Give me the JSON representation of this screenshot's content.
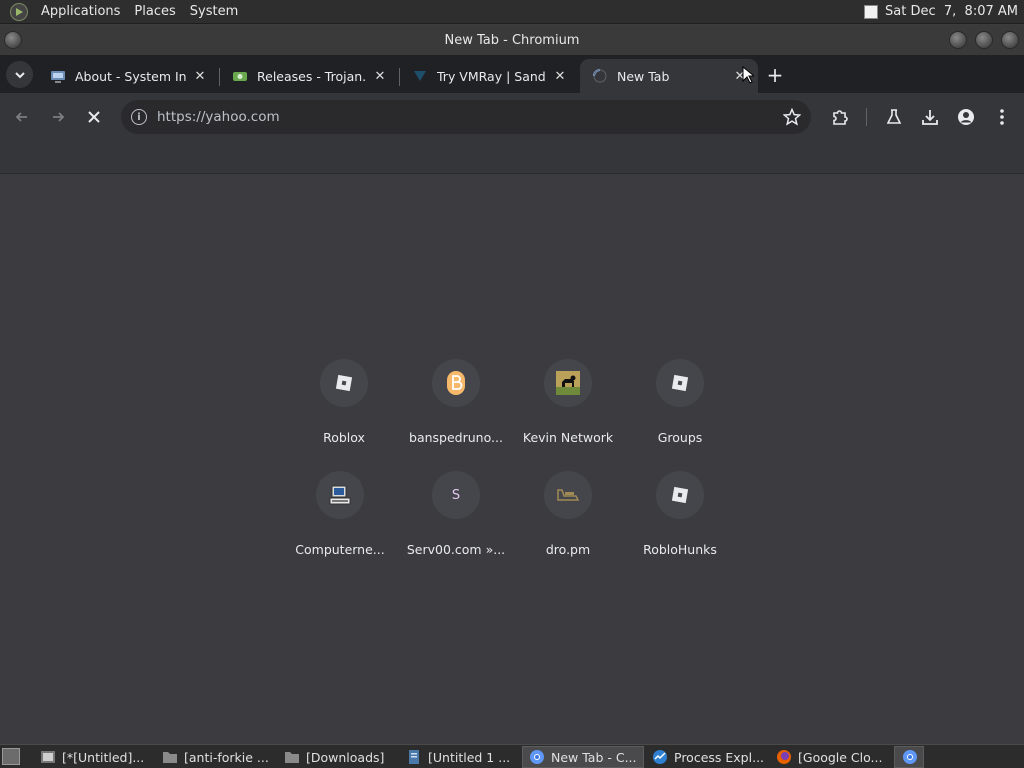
{
  "system_panel": {
    "menus": [
      "Applications",
      "Places",
      "System"
    ],
    "clock": "Sat Dec  7,  8:07 AM"
  },
  "window": {
    "title": "New Tab - Chromium"
  },
  "tabs": [
    {
      "title": "About - System Inf",
      "icon": "system-info-icon",
      "active": false
    },
    {
      "title": "Releases - Trojan.c",
      "icon": "github-releases-icon",
      "active": false
    },
    {
      "title": "Try VMRay | Sandb",
      "icon": "vmray-icon",
      "active": false
    },
    {
      "title": "New Tab",
      "icon": "loading-spinner-icon",
      "active": true
    }
  ],
  "toolbar": {
    "url": "https://yahoo.com",
    "loading": true
  },
  "shortcuts": [
    {
      "label": "Roblox",
      "icon": "roblox-icon"
    },
    {
      "label": "banspedruno...",
      "icon": "banspedrun-icon"
    },
    {
      "label": "Kevin Network",
      "icon": "kevin-network-icon"
    },
    {
      "label": "Groups",
      "icon": "roblox-icon"
    },
    {
      "label": "Computerne...",
      "icon": "computer-icon"
    },
    {
      "label": "Serv00.com »...",
      "icon": "letter-s-icon",
      "letter": "S"
    },
    {
      "label": "dro.pm",
      "icon": "dro-pm-icon"
    },
    {
      "label": "RobloHunks",
      "icon": "roblox-icon"
    }
  ],
  "taskbar": {
    "items": [
      {
        "label": "[*[Untitled]...",
        "icon": "editor-icon"
      },
      {
        "label": "[anti-forkie ...",
        "icon": "folder-icon"
      },
      {
        "label": "[Downloads]",
        "icon": "folder-icon"
      },
      {
        "label": "[Untitled 1 ...",
        "icon": "document-icon"
      },
      {
        "label": "New Tab - C...",
        "icon": "chromium-icon",
        "active": true
      },
      {
        "label": "Process Expl...",
        "icon": "process-explorer-icon"
      },
      {
        "label": "[Google Clo...",
        "icon": "firefox-icon"
      }
    ]
  },
  "colors": {
    "page_bg": "#3c3c40",
    "tabstrip_bg": "#202124",
    "toolbar_bg": "#35363a",
    "tile_bg": "#45464b"
  }
}
